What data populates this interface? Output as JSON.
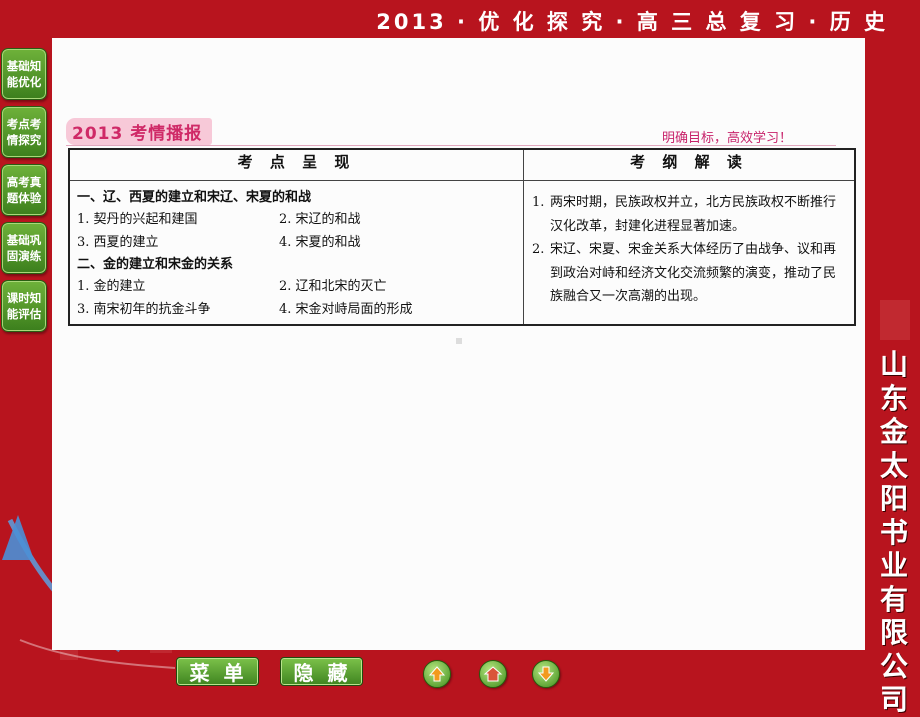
{
  "header": {
    "title": "2013 · 优 化 探 究 · 高 三 总 复 习 · 历 史"
  },
  "left_nav": {
    "items": [
      {
        "label": "基础知能优化"
      },
      {
        "label": "考点考情探究"
      },
      {
        "label": "高考真题体验"
      },
      {
        "label": "基础巩固演练"
      },
      {
        "label": "课时知能评估"
      }
    ]
  },
  "right_side": {
    "company": "山东金太阳书业有限公司"
  },
  "section": {
    "tag": "2013 考情播报",
    "motto": "明确目标，高效学习！"
  },
  "table": {
    "headers": [
      "考 点 呈 现",
      "考 纲 解 读"
    ],
    "left": {
      "section1_title": "一、辽、西夏的建立和宋辽、宋夏的和战",
      "section1_items": [
        [
          "1. 契丹的兴起和建国",
          "2. 宋辽的和战"
        ],
        [
          "3. 西夏的建立",
          "4. 宋夏的和战"
        ]
      ],
      "section2_title": "二、金的建立和宋金的关系",
      "section2_items": [
        [
          "1. 金的建立",
          "2. 辽和北宋的灭亡"
        ],
        [
          "3. 南宋初年的抗金斗争",
          "4. 宋金对峙局面的形成"
        ]
      ]
    },
    "right": [
      {
        "num": "1.",
        "text": "两宋时期，民族政权并立，北方民族政权不断推行汉化改革，封建化进程显著加速。"
      },
      {
        "num": "2.",
        "text": "宋辽、宋夏、宋金关系大体经历了由战争、议和再到政治对峙和经济文化交流频繁的演变，推动了民族融合又一次高潮的出现。"
      }
    ]
  },
  "bottom_bar": {
    "menu_label": "菜单",
    "hide_label": "隐藏"
  },
  "colors": {
    "background": "#b8141e",
    "nav_green": "#4f9a29",
    "tag_pink": "#f7c9d8",
    "tag_text": "#cf2a67"
  }
}
